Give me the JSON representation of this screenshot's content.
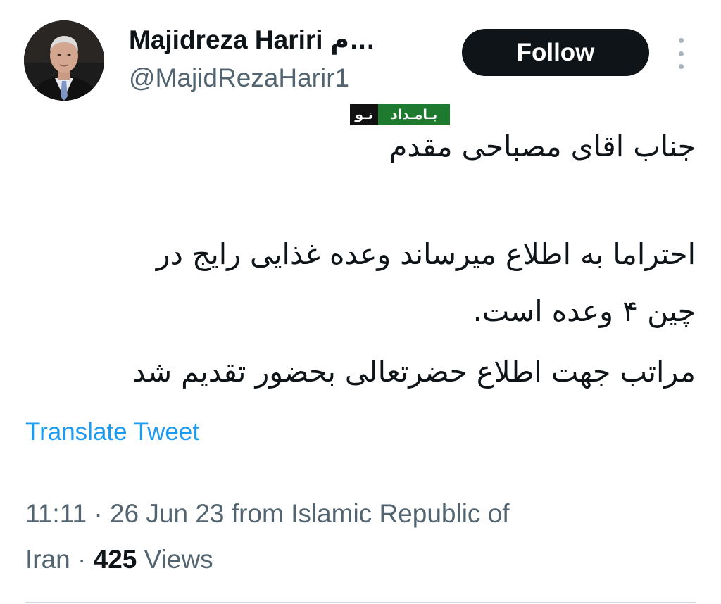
{
  "header": {
    "display_name": "Majidreza Hariri م…",
    "handle": "@MajidRezaHarir1",
    "follow_label": "Follow",
    "more_icon": "more-vertical-icon"
  },
  "watermark": {
    "dark_text": "نـو",
    "green_text": "بـامـداد"
  },
  "tweet": {
    "lines": [
      "جناب اقای مصباحی مقدم",
      "احتراما به اطلاع میرساند وعده غذایی رایج در",
      "چین ۴ وعده است.",
      "مراتب جهت اطلاع حضرتعالی بحضور تقدیم شد"
    ],
    "translate_label": "Translate Tweet"
  },
  "meta": {
    "line_1": "11:11 · 26 Jun 23 from Islamic Republic of",
    "line_2_prefix": "Iran · ",
    "views_count": "425",
    "views_label": " Views"
  },
  "colors": {
    "link": "#1d9bf0",
    "secondary_text": "#536471",
    "follow_bg": "#0f1419",
    "watermark_green": "#1e7a2f"
  }
}
